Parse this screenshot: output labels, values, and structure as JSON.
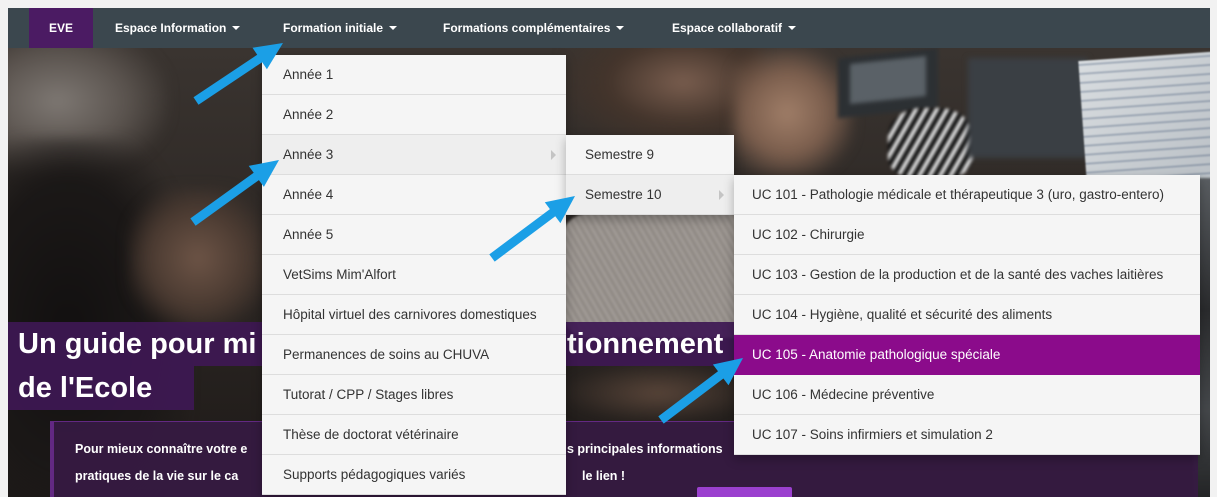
{
  "nav": {
    "brand": "EVE",
    "items": [
      {
        "label": "Espace Information",
        "icon": "caret-down-icon"
      },
      {
        "label": "Formation initiale",
        "icon": "caret-down-icon",
        "open": true
      },
      {
        "label": "Formations complémentaires",
        "icon": "caret-down-icon"
      },
      {
        "label": "Espace collaboratif",
        "icon": "caret-down-icon"
      }
    ]
  },
  "menus": {
    "formation_initiale": {
      "items": [
        {
          "label": "Année 1"
        },
        {
          "label": "Année 2"
        },
        {
          "label": "Année 3",
          "icon": "chevron-right-icon",
          "open": true
        },
        {
          "label": "Année 4"
        },
        {
          "label": "Année 5"
        },
        {
          "label": "VetSims Mim'Alfort"
        },
        {
          "label": "Hôpital virtuel des carnivores domestiques"
        },
        {
          "label": "Permanences de soins au CHUVA"
        },
        {
          "label": "Tutorat / CPP / Stages libres"
        },
        {
          "label": "Thèse de doctorat vétérinaire"
        },
        {
          "label": "Supports pédagogiques variés"
        }
      ]
    },
    "annee_3": {
      "items": [
        {
          "label": "Semestre 9"
        },
        {
          "label": "Semestre 10",
          "icon": "chevron-right-icon",
          "open": true
        }
      ]
    },
    "semestre_10": {
      "items": [
        {
          "label": "UC 101 - Pathologie médicale et thérapeutique 3 (uro, gastro-entero)"
        },
        {
          "label": "UC 102 - Chirurgie"
        },
        {
          "label": "UC 103 - Gestion de la production et de la santé des vaches laitières"
        },
        {
          "label": "UC 104 - Hygiène, qualité et sécurité des aliments"
        },
        {
          "label": "UC 105 - Anatomie pathologique spéciale",
          "active": true
        },
        {
          "label": "UC 106 - Médecine préventive"
        },
        {
          "label": "UC 107 - Soins infirmiers et simulation 2"
        }
      ]
    }
  },
  "hero": {
    "title_fragments": [
      "Un guide pour mi",
      "tionnement",
      "de l'Ecole"
    ],
    "text_fragments": [
      "Pour mieux connaître votre e",
      "s principales informations",
      "pratiques de la vie sur le ca",
      "le lien !"
    ]
  },
  "annotation_arrows": {
    "icon": "arrow-annotation-icon",
    "color": "#1b9fe6"
  },
  "colors": {
    "nav_bg": "#3b474e",
    "brand_bg": "#4b1b63",
    "menu_bg": "#f5f5f5",
    "menu_open_bg": "#eeeeee",
    "active_bg": "#8b0b8b",
    "heading_bg": "#3e1854",
    "text_box_bg": "#371a44",
    "text_box_border": "#6b2b8f",
    "cta": "#9b40cf",
    "arrow": "#1b9fe6"
  }
}
